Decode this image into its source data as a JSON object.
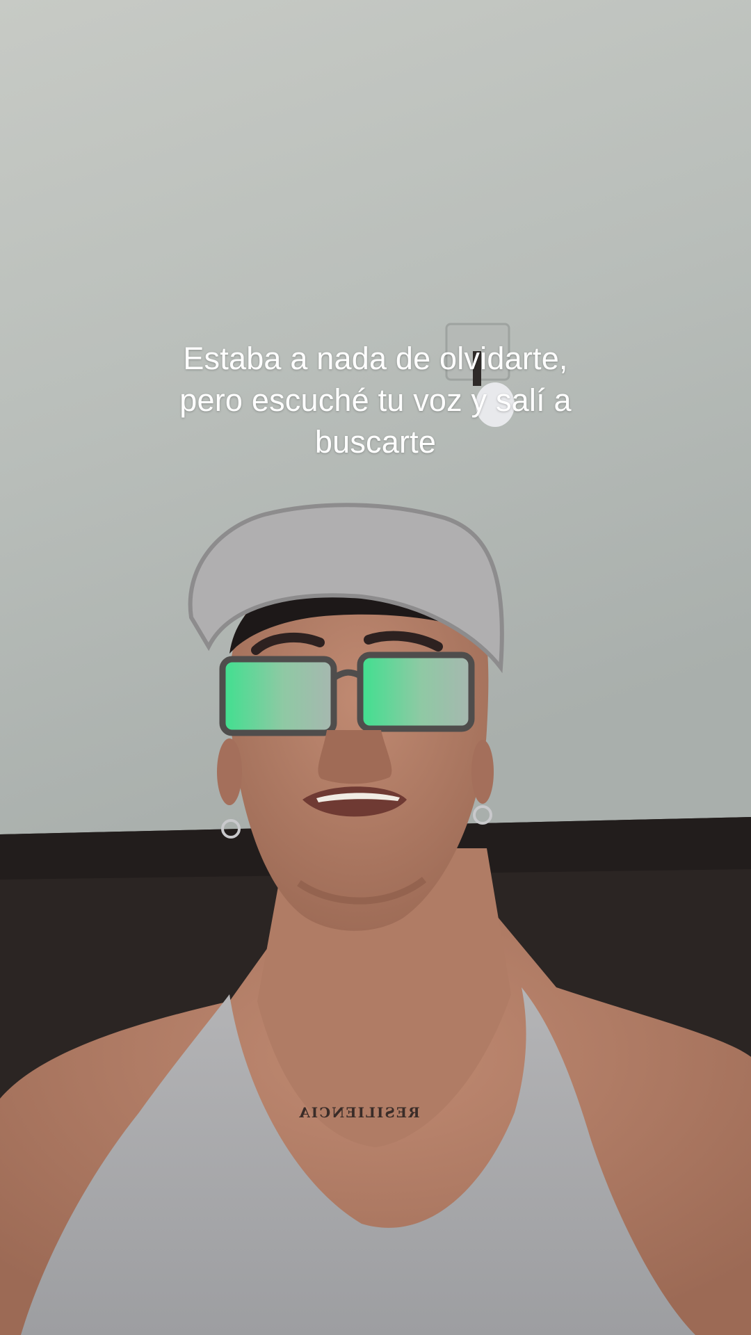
{
  "caption": {
    "line1": "Estaba a nada de olvidarte,",
    "line2": "pero escuché tu voz y salí a",
    "line3": "buscarte"
  },
  "tattoo": {
    "text": "RESILIENCIA",
    "mirrored": true
  },
  "colors": {
    "ceiling": "#b8bdba",
    "wall_dark": "#2a2422",
    "skin": "#b07c65",
    "tank_top": "#a9a9ab",
    "cap": "#b3b2b2",
    "lens_glare": "#3fd88f",
    "caption_text": "#ffffff"
  }
}
